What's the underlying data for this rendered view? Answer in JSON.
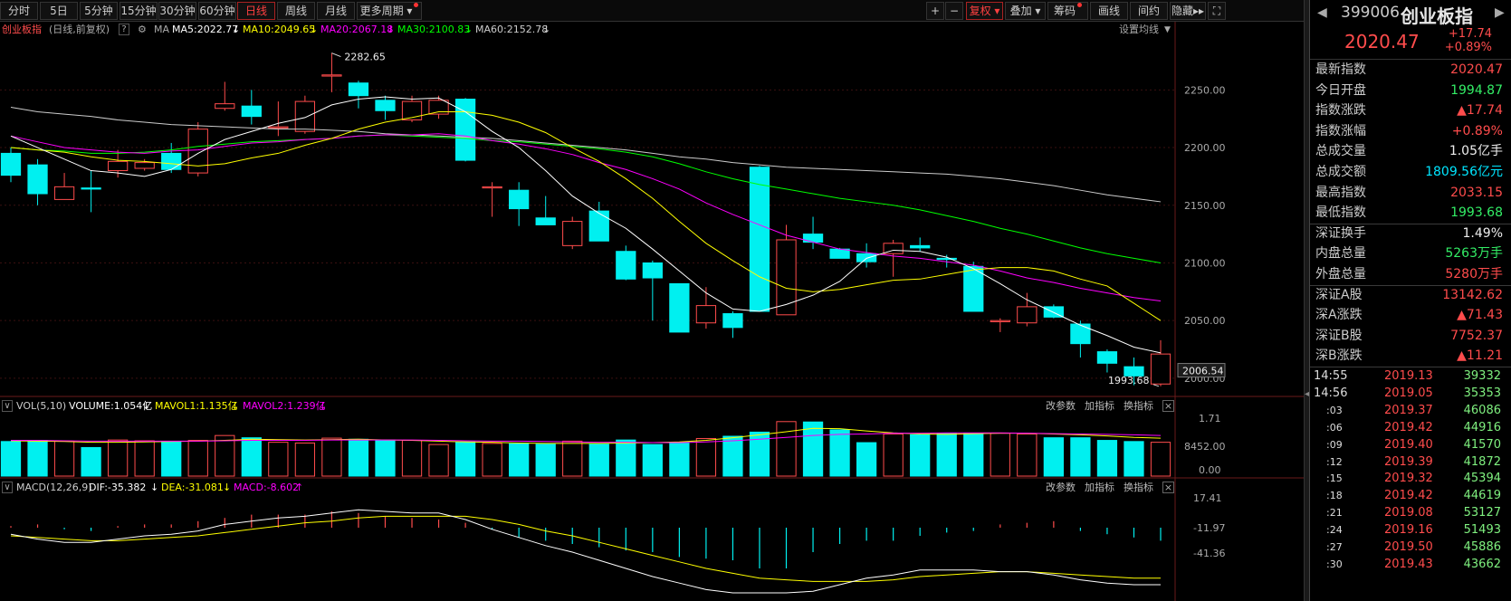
{
  "toolbar": {
    "periods": [
      "分时",
      "5日",
      "5分钟",
      "15分钟",
      "30分钟",
      "60分钟",
      "日线",
      "周线",
      "月线",
      "更多周期"
    ],
    "active_period": "日线",
    "right_buttons": [
      "+",
      "−",
      "复权",
      "叠加",
      "筹码",
      "画线",
      "间约",
      "隐藏"
    ],
    "right_icons": [
      "plus-icon",
      "minus-icon",
      "restore-rights-dropdown",
      "overlay-dropdown",
      "chip-button",
      "draw-line-button",
      "question-button",
      "hide-button"
    ]
  },
  "main_header": {
    "index_name": "创业板指",
    "mode": "(日线,前复权)",
    "ma_label": "MA",
    "ma5": "MA5:2022.77",
    "ma10": "MA10:2049.65",
    "ma20": "MA20:2067.18",
    "ma30": "MA30:2100.83",
    "ma60": "MA60:2152.78",
    "settings": "设置均线"
  },
  "vol_header": {
    "label": "VOL(5,10)",
    "volume": "VOLUME:1.054亿",
    "mavol1": "MAVOL1:1.135亿",
    "mavol2": "MAVOL2:1.239亿",
    "buttons": [
      "改参数",
      "加指标",
      "换指标"
    ]
  },
  "macd_header": {
    "label": "MACD(12,26,9)",
    "dif": "DIF:-35.382",
    "dea": "DEA:-31.081",
    "macd": "MACD:-8.602",
    "buttons": [
      "改参数",
      "加指标",
      "换指标"
    ]
  },
  "axis": {
    "price_ticks": [
      "2250.00",
      "2200.00",
      "2150.00",
      "2100.00",
      "2050.00",
      "2000.00"
    ],
    "current_price_tag": "2006.54",
    "high_annotation": "2282.65",
    "low_annotation": "1993.68",
    "vol_ticks": [
      "1.71",
      "8452.00",
      "0.00"
    ],
    "macd_ticks": [
      "17.41",
      "-11.97",
      "-41.36"
    ]
  },
  "colors": {
    "up": "#ff4c4c",
    "down": "#00f0f0",
    "ma5": "#ffffff",
    "ma10": "#ffff00",
    "ma20": "#ff00ff",
    "ma30": "#00ff00",
    "ma60": "#cccccc"
  },
  "chart_data": {
    "type": "candlestick",
    "ylim": [
      1985,
      2295
    ],
    "candles": [
      {
        "o": 2195,
        "c": 2176,
        "h": 2200,
        "l": 2170
      },
      {
        "o": 2185,
        "c": 2160,
        "h": 2190,
        "l": 2150
      },
      {
        "o": 2155,
        "c": 2166,
        "h": 2178,
        "l": 2155
      },
      {
        "o": 2165,
        "c": 2164,
        "h": 2180,
        "l": 2144
      },
      {
        "o": 2180,
        "c": 2188,
        "h": 2198,
        "l": 2174
      },
      {
        "o": 2182,
        "c": 2187,
        "h": 2190,
        "l": 2180
      },
      {
        "o": 2195,
        "c": 2181,
        "h": 2204,
        "l": 2178
      },
      {
        "o": 2178,
        "c": 2216,
        "h": 2222,
        "l": 2175
      },
      {
        "o": 2234,
        "c": 2238,
        "h": 2257,
        "l": 2232
      },
      {
        "o": 2236,
        "c": 2227,
        "h": 2250,
        "l": 2220
      },
      {
        "o": 2217,
        "c": 2218,
        "h": 2240,
        "l": 2210
      },
      {
        "o": 2214,
        "c": 2240,
        "h": 2245,
        "l": 2212
      },
      {
        "o": 2262,
        "c": 2263,
        "h": 2282,
        "l": 2248
      },
      {
        "o": 2256,
        "c": 2245,
        "h": 2258,
        "l": 2234
      },
      {
        "o": 2241,
        "c": 2232,
        "h": 2245,
        "l": 2224
      },
      {
        "o": 2224,
        "c": 2240,
        "h": 2245,
        "l": 2222
      },
      {
        "o": 2229,
        "c": 2241,
        "h": 2245,
        "l": 2225
      },
      {
        "o": 2242,
        "c": 2189,
        "h": 2243,
        "l": 2188
      },
      {
        "o": 2165,
        "c": 2166,
        "h": 2170,
        "l": 2140
      },
      {
        "o": 2163,
        "c": 2147,
        "h": 2170,
        "l": 2132
      },
      {
        "o": 2139,
        "c": 2133,
        "h": 2158,
        "l": 2133
      },
      {
        "o": 2115,
        "c": 2136,
        "h": 2140,
        "l": 2112
      },
      {
        "o": 2145,
        "c": 2119,
        "h": 2153,
        "l": 2119
      },
      {
        "o": 2110,
        "c": 2086,
        "h": 2115,
        "l": 2085
      },
      {
        "o": 2100,
        "c": 2087,
        "h": 2102,
        "l": 2050
      },
      {
        "o": 2082,
        "c": 2040,
        "h": 2082,
        "l": 2040
      },
      {
        "o": 2048,
        "c": 2063,
        "h": 2079,
        "l": 2043
      },
      {
        "o": 2056,
        "c": 2044,
        "h": 2058,
        "l": 2035
      },
      {
        "o": 2183,
        "c": 2058,
        "h": 2184,
        "l": 2058
      },
      {
        "o": 2055,
        "c": 2120,
        "h": 2133,
        "l": 2055
      },
      {
        "o": 2125,
        "c": 2118,
        "h": 2140,
        "l": 2112
      },
      {
        "o": 2112,
        "c": 2104,
        "h": 2113,
        "l": 2104
      },
      {
        "o": 2108,
        "c": 2101,
        "h": 2117,
        "l": 2096
      },
      {
        "o": 2108,
        "c": 2117,
        "h": 2120,
        "l": 2088
      },
      {
        "o": 2115,
        "c": 2113,
        "h": 2122,
        "l": 2110
      },
      {
        "o": 2104,
        "c": 2103,
        "h": 2107,
        "l": 2096
      },
      {
        "o": 2097,
        "c": 2058,
        "h": 2101,
        "l": 2058
      },
      {
        "o": 2049,
        "c": 2050,
        "h": 2052,
        "l": 2040
      },
      {
        "o": 2048,
        "c": 2062,
        "h": 2074,
        "l": 2045
      },
      {
        "o": 2062,
        "c": 2053,
        "h": 2064,
        "l": 2052
      },
      {
        "o": 2047,
        "c": 2030,
        "h": 2050,
        "l": 2018
      },
      {
        "o": 2023,
        "c": 2013,
        "h": 2025,
        "l": 2005
      },
      {
        "o": 2010,
        "c": 2002,
        "h": 2018,
        "l": 1994
      },
      {
        "o": 1995,
        "c": 2021,
        "h": 2033,
        "l": 1993
      }
    ],
    "ma5": [
      2210,
      2200,
      2190,
      2180,
      2178,
      2175,
      2181,
      2195,
      2207,
      2214,
      2221,
      2226,
      2237,
      2242,
      2244,
      2242,
      2243,
      2231,
      2214,
      2200,
      2180,
      2158,
      2143,
      2130,
      2112,
      2093,
      2074,
      2060,
      2058,
      2064,
      2072,
      2084,
      2104,
      2111,
      2110,
      2105,
      2095,
      2082,
      2068,
      2057,
      2046,
      2037,
      2027,
      2022
    ],
    "ma10": [
      2200,
      2198,
      2196,
      2192,
      2189,
      2188,
      2186,
      2184,
      2186,
      2191,
      2195,
      2202,
      2208,
      2216,
      2222,
      2226,
      2231,
      2231,
      2228,
      2222,
      2213,
      2200,
      2188,
      2173,
      2156,
      2136,
      2117,
      2102,
      2088,
      2078,
      2075,
      2077,
      2081,
      2085,
      2086,
      2090,
      2094,
      2096,
      2096,
      2093,
      2086,
      2080,
      2065,
      2050
    ],
    "ma20": [
      2210,
      2205,
      2200,
      2198,
      2196,
      2195,
      2197,
      2198,
      2201,
      2204,
      2205,
      2207,
      2208,
      2210,
      2211,
      2211,
      2212,
      2210,
      2206,
      2203,
      2199,
      2194,
      2187,
      2181,
      2173,
      2164,
      2152,
      2142,
      2133,
      2124,
      2118,
      2112,
      2109,
      2106,
      2104,
      2101,
      2098,
      2093,
      2087,
      2083,
      2078,
      2074,
      2070,
      2067
    ],
    "ma30": [
      2200,
      2198,
      2197,
      2195,
      2195,
      2196,
      2198,
      2201,
      2203,
      2205,
      2206,
      2207,
      2208,
      2210,
      2211,
      2210,
      2209,
      2208,
      2206,
      2205,
      2203,
      2201,
      2199,
      2196,
      2192,
      2186,
      2179,
      2173,
      2168,
      2164,
      2160,
      2156,
      2153,
      2150,
      2146,
      2141,
      2136,
      2130,
      2125,
      2119,
      2113,
      2108,
      2104,
      2100
    ],
    "ma60": [
      2235,
      2231,
      2229,
      2227,
      2224,
      2222,
      2220,
      2219,
      2218,
      2217,
      2216,
      2216,
      2215,
      2214,
      2212,
      2211,
      2210,
      2209,
      2208,
      2206,
      2204,
      2202,
      2200,
      2198,
      2195,
      2192,
      2190,
      2187,
      2185,
      2183,
      2182,
      2181,
      2180,
      2179,
      2178,
      2177,
      2175,
      2173,
      2170,
      2167,
      2163,
      2159,
      2156,
      2153
    ],
    "volume": [
      0.92,
      0.95,
      0.93,
      0.76,
      0.96,
      0.94,
      0.92,
      0.95,
      1.08,
      1.02,
      0.9,
      0.88,
      1.01,
      0.98,
      0.96,
      0.95,
      0.84,
      0.91,
      0.87,
      0.86,
      0.85,
      0.93,
      0.85,
      0.96,
      0.84,
      0.9,
      1.0,
      1.06,
      1.17,
      1.45,
      1.44,
      1.23,
      0.89,
      1.12,
      1.1,
      1.14,
      1.14,
      1.14,
      1.12,
      1.02,
      1.02,
      0.95,
      0.92,
      0.9
    ],
    "mavol_ylim": [
      0,
      1.71
    ],
    "mavol1": [
      0.94,
      0.93,
      0.92,
      0.9,
      0.9,
      0.91,
      0.92,
      0.93,
      0.95,
      0.98,
      0.97,
      0.96,
      0.97,
      0.98,
      0.96,
      0.95,
      0.93,
      0.91,
      0.9,
      0.88,
      0.87,
      0.87,
      0.87,
      0.88,
      0.89,
      0.91,
      0.95,
      1.02,
      1.1,
      1.18,
      1.27,
      1.26,
      1.2,
      1.15,
      1.12,
      1.11,
      1.13,
      1.14,
      1.14,
      1.12,
      1.1,
      1.07,
      1.03,
      1.01
    ],
    "mavol2": [
      0.95,
      0.95,
      0.94,
      0.93,
      0.93,
      0.93,
      0.93,
      0.93,
      0.94,
      0.95,
      0.95,
      0.95,
      0.96,
      0.96,
      0.96,
      0.96,
      0.95,
      0.94,
      0.93,
      0.93,
      0.92,
      0.91,
      0.9,
      0.9,
      0.89,
      0.89,
      0.91,
      0.94,
      0.98,
      1.03,
      1.08,
      1.11,
      1.12,
      1.14,
      1.14,
      1.15,
      1.15,
      1.15,
      1.14,
      1.13,
      1.12,
      1.11,
      1.1,
      1.08
    ],
    "macd_ylim": [
      -45,
      20
    ],
    "macd": [
      1,
      2,
      -1,
      -2,
      1,
      2,
      2,
      4,
      6,
      8,
      8,
      8,
      10,
      9,
      7,
      6,
      5,
      3,
      -1,
      -6,
      -8,
      -10,
      -12,
      -14,
      -15,
      -18,
      -19,
      -20,
      -25,
      -25,
      -15,
      -10,
      -8,
      -8,
      -5,
      -3,
      -2,
      2,
      3,
      4,
      -2,
      -4,
      -6,
      -8
    ],
    "dif": [
      -4,
      -7,
      -9,
      -9,
      -7,
      -5,
      -4,
      -2,
      2,
      4,
      6,
      7,
      9,
      11,
      10,
      9,
      9,
      5,
      -1,
      -6,
      -11,
      -15,
      -20,
      -25,
      -30,
      -34,
      -38,
      -40,
      -40,
      -40,
      -39,
      -35,
      -31,
      -29,
      -26,
      -26,
      -26,
      -27,
      -27,
      -29,
      -32,
      -34,
      -35,
      -35
    ],
    "dea": [
      -5,
      -6,
      -7,
      -8,
      -8,
      -7,
      -6,
      -5,
      -3,
      -1,
      1,
      3,
      4,
      6,
      7,
      7,
      7,
      7,
      5,
      2,
      -2,
      -5,
      -9,
      -13,
      -17,
      -21,
      -25,
      -28,
      -31,
      -32,
      -33,
      -33,
      -33,
      -32,
      -30,
      -29,
      -28,
      -27,
      -27,
      -28,
      -29,
      -30,
      -31,
      -31
    ]
  },
  "right_panel": {
    "code": "399006",
    "name": "创业板指",
    "price": "2020.47",
    "change": "+17.74",
    "change_pct": "+0.89%",
    "quotes": [
      {
        "k": "最新指数",
        "v": "2020.47",
        "c": "red"
      },
      {
        "k": "今日开盘",
        "v": "1994.87",
        "c": "grn"
      },
      {
        "k": "指数涨跌",
        "v": "▲17.74",
        "c": "red"
      },
      {
        "k": "指数涨幅",
        "v": "+0.89%",
        "c": "red"
      },
      {
        "k": "总成交量",
        "v": "1.05亿手",
        "c": "wht"
      },
      {
        "k": "总成交额",
        "v": "1809.56亿元",
        "c": "cyn"
      },
      {
        "k": "最高指数",
        "v": "2033.15",
        "c": "red"
      },
      {
        "k": "最低指数",
        "v": "1993.68",
        "c": "grn"
      },
      {
        "k": "深证换手",
        "v": "1.49%",
        "c": "wht"
      },
      {
        "k": "内盘总量",
        "v": "5263万手",
        "c": "grn"
      },
      {
        "k": "外盘总量",
        "v": "5280万手",
        "c": "red"
      },
      {
        "k": "深证A股",
        "v": "13142.62",
        "c": "red"
      },
      {
        "k": "深A涨跌",
        "v": "▲71.43",
        "c": "red"
      },
      {
        "k": "深证B股",
        "v": "7752.37",
        "c": "red"
      },
      {
        "k": "深B涨跌",
        "v": "▲11.21",
        "c": "red"
      }
    ],
    "ticks": [
      {
        "t": "14:55",
        "p": "2019.13",
        "v": "39332"
      },
      {
        "t": "14:56",
        "p": "2019.05",
        "v": "35353"
      },
      {
        "t": ":03",
        "p": "2019.37",
        "v": "46086"
      },
      {
        "t": ":06",
        "p": "2019.42",
        "v": "44916"
      },
      {
        "t": ":09",
        "p": "2019.40",
        "v": "41570"
      },
      {
        "t": ":12",
        "p": "2019.39",
        "v": "41872"
      },
      {
        "t": ":15",
        "p": "2019.32",
        "v": "45394"
      },
      {
        "t": ":18",
        "p": "2019.42",
        "v": "44619"
      },
      {
        "t": ":21",
        "p": "2019.08",
        "v": "53127"
      },
      {
        "t": ":24",
        "p": "2019.16",
        "v": "51493"
      },
      {
        "t": ":27",
        "p": "2019.50",
        "v": "45886"
      },
      {
        "t": ":30",
        "p": "2019.43",
        "v": "43662"
      }
    ]
  }
}
